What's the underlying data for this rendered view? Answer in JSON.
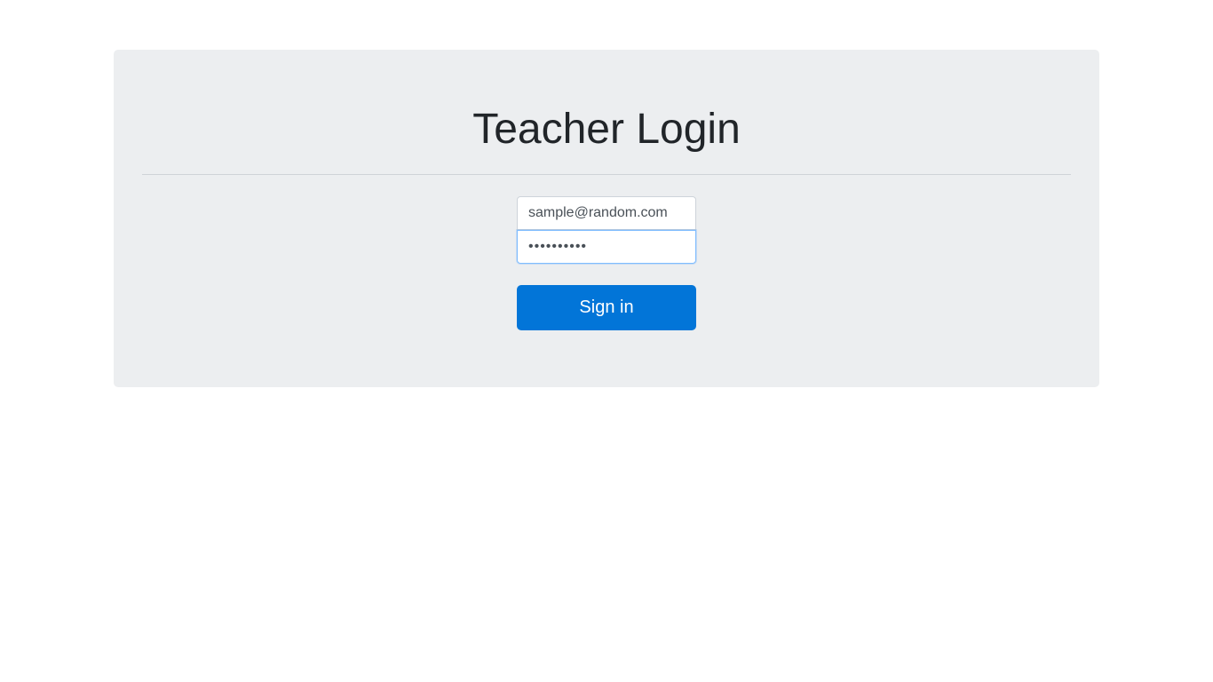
{
  "login": {
    "title": "Teacher Login",
    "email_value": "sample@random.com",
    "password_value": "••••••••••",
    "sign_in_label": "Sign in"
  },
  "colors": {
    "panel_background": "#eceef0",
    "primary_button": "#0275d8",
    "focus_border": "#80bdff"
  }
}
